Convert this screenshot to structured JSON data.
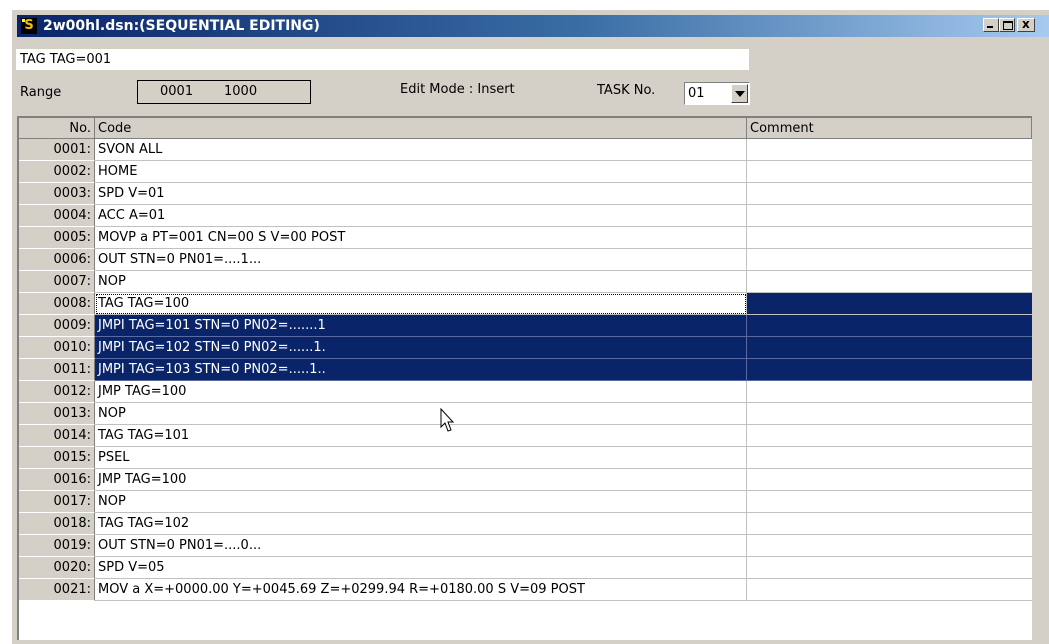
{
  "window": {
    "title": "2w00hl.dsn:(SEQUENTIAL EDITING)"
  },
  "toolbar": {
    "tag_line": "TAG TAG=001",
    "range_label": "Range",
    "range_start": "0001",
    "range_end": "1000",
    "edit_mode": "Edit Mode : Insert",
    "task_label": "TASK No.",
    "task_value": "01"
  },
  "table": {
    "headers": {
      "no": "No.",
      "code": "Code",
      "comment": "Comment"
    },
    "rows": [
      {
        "no": "0001:",
        "code": "SVON ALL",
        "comment": ""
      },
      {
        "no": "0002:",
        "code": "HOME",
        "comment": ""
      },
      {
        "no": "0003:",
        "code": "SPD V=01",
        "comment": ""
      },
      {
        "no": "0004:",
        "code": "ACC A=01",
        "comment": ""
      },
      {
        "no": "0005:",
        "code": "MOVP a PT=001 CN=00 S V=00 POST",
        "comment": ""
      },
      {
        "no": "0006:",
        "code": "OUT STN=0 PN01=....1...",
        "comment": ""
      },
      {
        "no": "0007:",
        "code": "NOP",
        "comment": ""
      },
      {
        "no": "0008:",
        "code": "TAG TAG=100",
        "comment": ""
      },
      {
        "no": "0009:",
        "code": "JMPI TAG=101 STN=0 PN02=.......1",
        "comment": ""
      },
      {
        "no": "0010:",
        "code": "JMPI TAG=102 STN=0 PN02=......1.",
        "comment": ""
      },
      {
        "no": "0011:",
        "code": "JMPI TAG=103 STN=0 PN02=.....1..",
        "comment": ""
      },
      {
        "no": "0012:",
        "code": "JMP TAG=100",
        "comment": ""
      },
      {
        "no": "0013:",
        "code": "NOP",
        "comment": ""
      },
      {
        "no": "0014:",
        "code": "TAG TAG=101",
        "comment": ""
      },
      {
        "no": "0015:",
        "code": "PSEL",
        "comment": ""
      },
      {
        "no": "0016:",
        "code": "JMP TAG=100",
        "comment": ""
      },
      {
        "no": "0017:",
        "code": "NOP",
        "comment": ""
      },
      {
        "no": "0018:",
        "code": "TAG TAG=102",
        "comment": ""
      },
      {
        "no": "0019:",
        "code": "OUT STN=0 PN01=....0...",
        "comment": ""
      },
      {
        "no": "0020:",
        "code": "SPD V=05",
        "comment": ""
      },
      {
        "no": "0021:",
        "code": "MOV a X=+0000.00 Y=+0045.69 Z=+0299.94 R=+0180.00 S V=09 POST",
        "comment": ""
      }
    ]
  },
  "colors": {
    "title_bar": "#0a246a",
    "selection": "#0a246a",
    "face": "#d4d0c8"
  },
  "icons": [
    "app-s-icon",
    "minimize-icon",
    "maximize-icon",
    "close-icon",
    "dropdown-arrow-icon",
    "scroll-up-icon",
    "scroll-down-icon",
    "mouse-pointer-icon"
  ]
}
